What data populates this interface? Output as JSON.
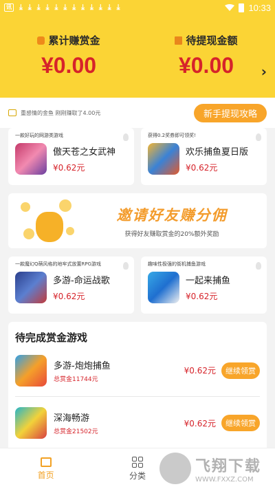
{
  "status_bar": {
    "time": "10:33"
  },
  "header": {
    "total_label": "累计赚赏金",
    "total_value": "¥0.00",
    "withdraw_label": "待提现金额",
    "withdraw_value": "¥0.00"
  },
  "notice": {
    "text": "重感情的金鱼 刚刚赚取了4.00元",
    "guide_button": "新手提现攻略"
  },
  "cards_row1": [
    {
      "tag": "一款好玩的网游类游戏",
      "title": "傲天苍之女武神",
      "price": "¥0.62元"
    },
    {
      "tag": "获得0.2奖券即可领奖!",
      "title": "欢乐捕鱼夏日版",
      "price": "¥0.62元"
    }
  ],
  "banner": {
    "title": "邀请好友赚分佣",
    "subtitle": "获得好友赚取赏金的20%额外奖励"
  },
  "cards_row2": [
    {
      "tag": "一款魔幻Q萌风格的地牢式放置RPG游戏",
      "title": "多游-命运战歌",
      "price": "¥0.62元"
    },
    {
      "tag": "趣味性极强的街机捕鱼游戏",
      "title": "一起来捕鱼",
      "price": "¥0.62元"
    }
  ],
  "pending": {
    "title": "待完成赏金游戏",
    "items": [
      {
        "name": "多游-炮炮捕鱼",
        "total": "总赏金11744元",
        "price": "¥0.62元",
        "button": "继续领赏"
      },
      {
        "name": "深海畅游",
        "total": "总赏金21502元",
        "price": "¥0.62元",
        "button": "继续领赏"
      }
    ]
  },
  "nav": {
    "home": "首页",
    "category": "分类"
  },
  "watermark": {
    "title": "飞翔下载",
    "url": "WWW.FXXZ.COM"
  }
}
